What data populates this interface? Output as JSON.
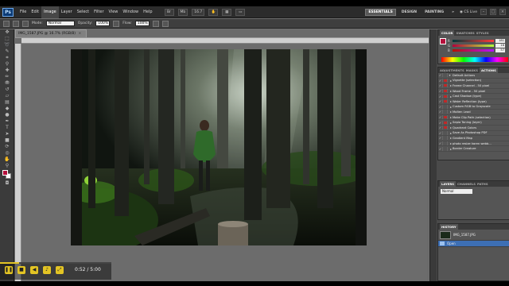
{
  "menubar": {
    "logo": "Ps",
    "items": [
      "File",
      "Edit",
      "Image",
      "Layer",
      "Select",
      "Filter",
      "View",
      "Window",
      "Help"
    ],
    "zoom": "16.7",
    "workspaces": [
      "ESSENTIALS",
      "DESIGN",
      "PAINTING"
    ],
    "more": "»",
    "cslive": "CS Live"
  },
  "options": {
    "mode_label": "Mode:",
    "mode_value": "Normal",
    "opacity_label": "Opacity:",
    "opacity_value": "100%",
    "flow_label": "Flow:",
    "flow_value": "100%"
  },
  "document": {
    "tab_title": "IMG_1587.JPG @ 16.7% (RGB/8)"
  },
  "color_panel": {
    "tabs": [
      "COLOR",
      "SWATCHES",
      "STYLES"
    ],
    "r": "181",
    "g": "16",
    "b": "57"
  },
  "actions_panel": {
    "tabs": [
      "ADJUSTMENTS",
      "MASKS",
      "ACTIONS"
    ],
    "set_name": "Default Actions",
    "items": [
      "Vignette (selection)",
      "Frame Channel - 50 pixel",
      "Wood Frame - 50 pixel",
      "Cast Shadow (type)",
      "Water Reflection (type)",
      "Custom RGB to Grayscale",
      "Molten Lead",
      "Make Clip Path (selection)",
      "Sepia Toning (layer)",
      "Quadrant Colors",
      "Save As Photoshop PDF",
      "Gradient Map",
      "photo resize karen webb...",
      "Border Creature"
    ]
  },
  "layers_panel": {
    "tabs": [
      "LAYERS",
      "CHANNELS",
      "PATHS"
    ],
    "blend": "Normal"
  },
  "history_panel": {
    "title": "HISTORY",
    "snapshot": "IMG_1587.JPG",
    "step": "Open"
  },
  "player": {
    "timecode": "0:52 / 5:00",
    "progress": 0.17
  },
  "colors": {
    "accent": "#e3c424",
    "foreground": "#b5103c",
    "ps_blue": "#0b3a74"
  }
}
